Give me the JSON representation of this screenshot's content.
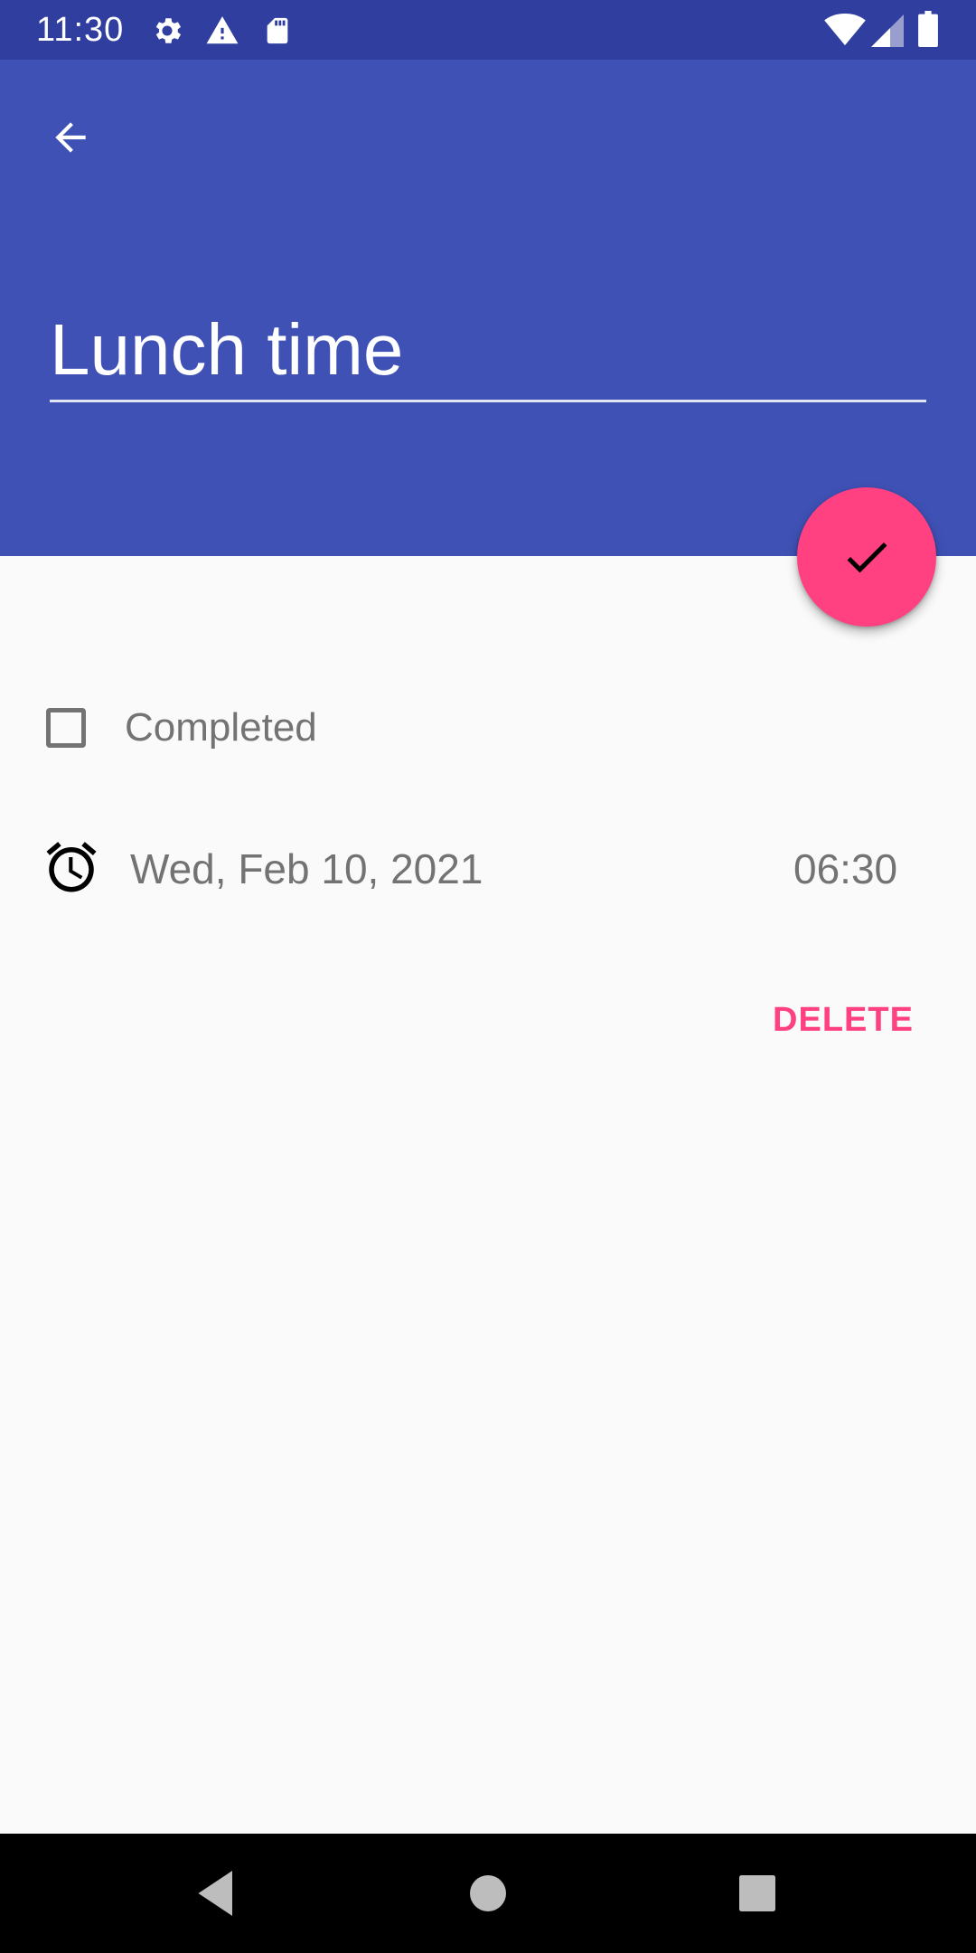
{
  "status_bar": {
    "time": "11:30",
    "icons": [
      "gear-icon",
      "warning-icon",
      "sd-card-icon",
      "wifi-icon",
      "signal-icon",
      "battery-icon"
    ]
  },
  "app_bar": {
    "back_icon": "arrow-left-icon",
    "title_value": "Lunch time"
  },
  "fab": {
    "icon": "check-icon"
  },
  "form": {
    "completed_label": "Completed",
    "completed_checked": false,
    "alarm_icon": "alarm-clock-icon",
    "date": "Wed, Feb 10, 2021",
    "time": "06:30"
  },
  "actions": {
    "delete_label": "DELETE"
  },
  "nav_bar": {
    "icons": [
      "back-triangle-icon",
      "home-circle-icon",
      "recents-square-icon"
    ]
  },
  "colors": {
    "primary": "#3f51b5",
    "primary_dark": "#303f9f",
    "accent": "#ff4081",
    "background": "#fafafa",
    "secondary_text": "#737373"
  }
}
